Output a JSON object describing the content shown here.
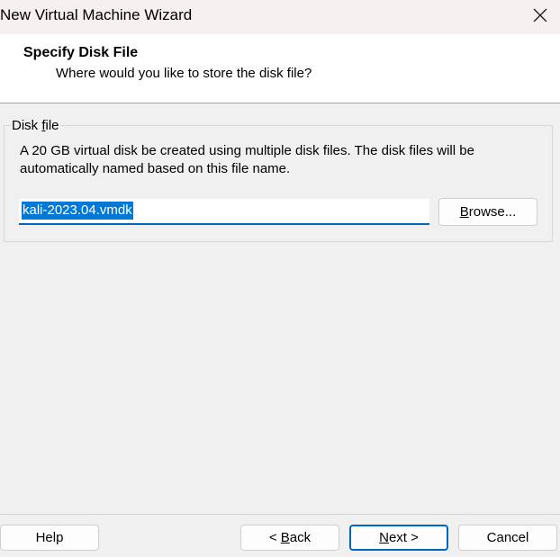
{
  "window": {
    "title": "New Virtual Machine Wizard"
  },
  "header": {
    "title": "Specify Disk File",
    "subtitle": "Where would you like to store the disk file?"
  },
  "disk_file": {
    "group_label_prefix": "Disk ",
    "group_label_accel": "f",
    "group_label_suffix": "ile",
    "description": "A 20 GB virtual disk be created using multiple disk files. The disk files will be automatically named based on this file name.",
    "filename": "kali-2023.04.vmdk",
    "browse_label_accel": "B",
    "browse_label_rest": "rowse..."
  },
  "footer": {
    "help_label": "Help",
    "back_prefix": "< ",
    "back_accel": "B",
    "back_rest": "ack",
    "next_accel": "N",
    "next_rest": "ext >",
    "cancel_label": "Cancel"
  },
  "colors": {
    "accent": "#0067c0",
    "selection": "#0078d7",
    "titlebar_bg": "#f6f1f0",
    "dialog_bg": "#f0f0f0"
  },
  "icons": {
    "close": "close-icon"
  }
}
